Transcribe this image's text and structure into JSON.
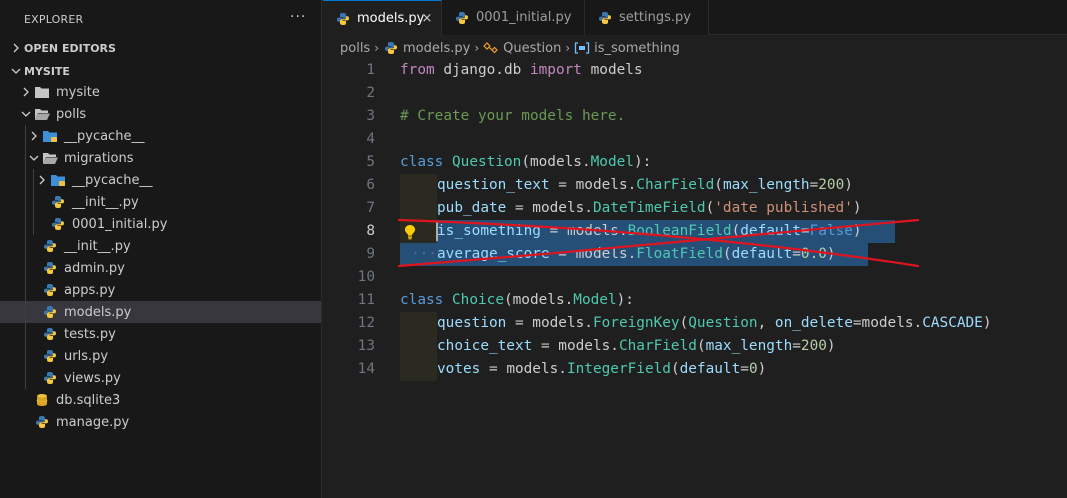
{
  "explorer": {
    "title": "EXPLORER",
    "more_label": "···",
    "sections": [
      {
        "label": "OPEN EDITORS",
        "expanded": false
      },
      {
        "label": "MYSITE",
        "expanded": true
      }
    ],
    "tree": [
      {
        "label": "mysite",
        "type": "folder",
        "expanded": false
      },
      {
        "label": "polls",
        "type": "folder",
        "expanded": true
      },
      {
        "label": "__pycache__",
        "type": "pkg-folder",
        "expanded": false
      },
      {
        "label": "migrations",
        "type": "folder",
        "expanded": true
      },
      {
        "label": "__pycache__",
        "type": "pkg-folder",
        "expanded": false
      },
      {
        "label": "__init__.py",
        "type": "python"
      },
      {
        "label": "0001_initial.py",
        "type": "python"
      },
      {
        "label": "__init__.py",
        "type": "python"
      },
      {
        "label": "admin.py",
        "type": "python"
      },
      {
        "label": "apps.py",
        "type": "python"
      },
      {
        "label": "models.py",
        "type": "python",
        "selected": true
      },
      {
        "label": "tests.py",
        "type": "python"
      },
      {
        "label": "urls.py",
        "type": "python"
      },
      {
        "label": "views.py",
        "type": "python"
      },
      {
        "label": "db.sqlite3",
        "type": "database"
      },
      {
        "label": "manage.py",
        "type": "python"
      }
    ]
  },
  "tabs": [
    {
      "label": "models.py",
      "active": true,
      "close": "×"
    },
    {
      "label": "0001_initial.py",
      "active": false
    },
    {
      "label": "settings.py",
      "active": false
    }
  ],
  "breadcrumb": {
    "folder": "polls",
    "file": "models.py",
    "class": "Question",
    "field": "is_something"
  },
  "code": {
    "line_numbers": [
      "1",
      "2",
      "3",
      "4",
      "5",
      "6",
      "7",
      "8",
      "9",
      "10",
      "11",
      "12",
      "13",
      "14"
    ],
    "current_line": "8",
    "lines": {
      "l1": {
        "from": "from",
        "mod": " django.db ",
        "import": "import",
        "name": " models"
      },
      "l3": {
        "comment": "# Create your models here."
      },
      "l5": {
        "kw": "class",
        "name": "Question",
        "p1": "(models.",
        "base": "Model",
        "p2": "):"
      },
      "l6": {
        "field": "question_text",
        "eq": " = models.",
        "type": "CharField",
        "open": "(",
        "param": "max_length",
        "eq2": "=",
        "num": "200",
        "close": ")"
      },
      "l7": {
        "field": "pub_date",
        "eq": " = models.",
        "type": "DateTimeField",
        "open": "(",
        "str": "'date published'",
        "close": ")"
      },
      "l8": {
        "field": "is_something",
        "eq": " = models.",
        "type": "BooleanField",
        "open": "(",
        "param": "default",
        "eq2": "=",
        "val": "False",
        "close": ")"
      },
      "l9": {
        "dots": "···",
        "field": "average_score",
        "eq": " = models.",
        "type": "FloatField",
        "open": "(",
        "param": "default",
        "eq2": "=",
        "num": "0.0",
        "close": ")"
      },
      "l11": {
        "kw": "class",
        "name": "Choice",
        "p1": "(models.",
        "base": "Model",
        "p2": "):"
      },
      "l12": {
        "field": "question",
        "eq": " = models.",
        "type": "ForeignKey",
        "open": "(",
        "arg": "Question",
        "comma": ", ",
        "param": "on_delete",
        "eq2": "=models.",
        "const": "CASCADE",
        "close": ")"
      },
      "l13": {
        "field": "choice_text",
        "eq": " = models.",
        "type": "CharField",
        "open": "(",
        "param": "max_length",
        "eq2": "=",
        "num": "200",
        "close": ")"
      },
      "l14": {
        "field": "votes",
        "eq": " = models.",
        "type": "IntegerField",
        "open": "(",
        "param": "default",
        "eq2": "=",
        "num": "0",
        "close": ")"
      }
    }
  },
  "colors": {
    "keyword": "#c586c0",
    "class_keyword": "#569cd6",
    "comment": "#6a9955",
    "class_name": "#4ec9b0",
    "parameter": "#9cdcfe",
    "number": "#b5cea8",
    "string": "#ce9178",
    "selection": "#264f78",
    "annotation_strike": "#e0141e",
    "lightbulb": "#ffcc00"
  }
}
